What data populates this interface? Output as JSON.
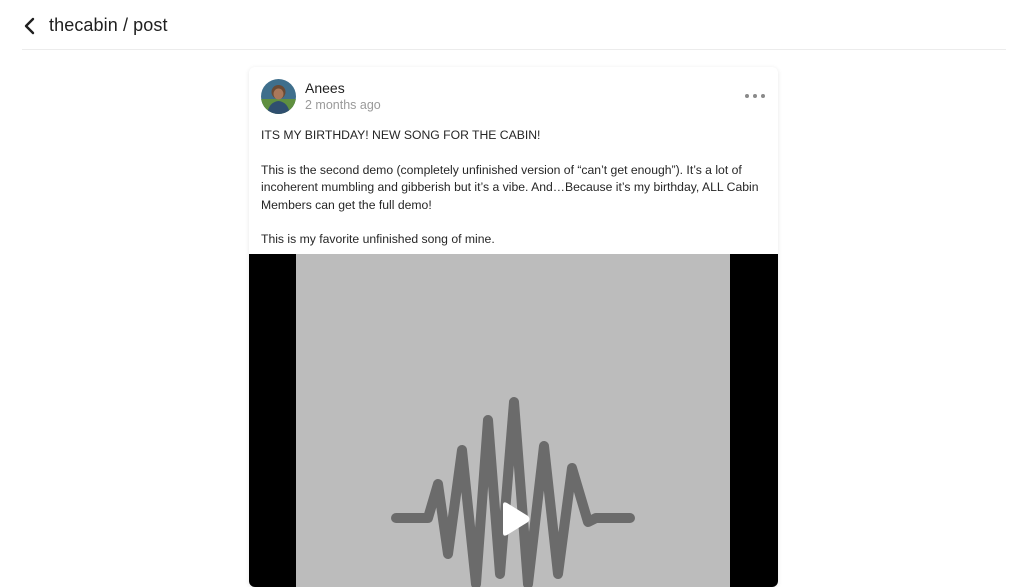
{
  "header": {
    "breadcrumb": "thecabin / post"
  },
  "post": {
    "author": "Anees",
    "time": "2 months ago",
    "paragraphs": [
      "ITS MY BIRTHDAY! NEW SONG FOR THE CABIN!",
      "This is the second demo (completely unfinished version of “can’t get enough”). It’s a lot of incoherent mumbling and gibberish but it’s a vibe. And…Because it’s my birthday, ALL Cabin Members can get the full demo!",
      "This is my favorite unfinished song of mine."
    ]
  },
  "icons": {
    "back": "chevron-left-icon",
    "more": "more-horizontal-icon",
    "play": "play-icon",
    "artwork": "sound-wave-icon"
  },
  "colors": {
    "artwork_background": "#bcbcbc",
    "waveform": "#6b6b6b",
    "letterbox": "#000000",
    "muted_text": "#9a9a9a"
  }
}
